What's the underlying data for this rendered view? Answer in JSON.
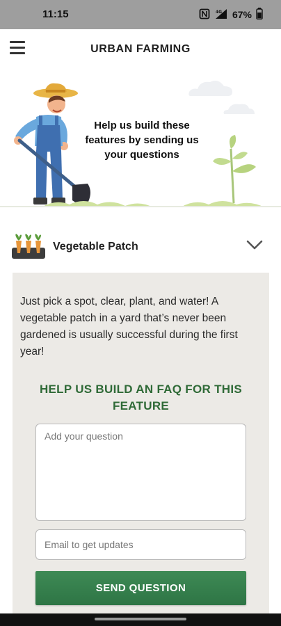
{
  "status_bar": {
    "time": "11:15",
    "battery": "67%",
    "icons": [
      "nfc-icon",
      "signal-4g-icon",
      "battery-icon"
    ],
    "signal_label": "4G"
  },
  "app_bar": {
    "title": "URBAN FARMING",
    "menu_icon": "hamburger-menu-icon"
  },
  "hero": {
    "text": "Help us build these features by sending us your questions",
    "illustrations": [
      "farmer-with-shovel-illustration",
      "sprouting-plant-illustration",
      "cloud-illustration"
    ]
  },
  "section": {
    "icon": "vegetable-patch-icon",
    "title": "Vegetable Patch",
    "expand_icon": "chevron-down-icon",
    "description": "Just pick a spot, clear, plant, and water! A vegetable patch in a yard that’s never been gardened is usually successful during the first year!",
    "faq_heading": "HELP US BUILD AN FAQ FOR THIS FEATURE",
    "question_placeholder": "Add your question",
    "email_placeholder": "Email to get updates",
    "send_label": "SEND QUESTION"
  },
  "colors": {
    "accent_green": "#2f6a37",
    "button_green": "#3a8351",
    "card_background": "#eceae6",
    "status_bar": "#9e9e9e"
  }
}
